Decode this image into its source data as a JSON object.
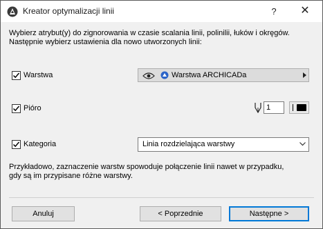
{
  "window": {
    "title": "Kreator optymalizacji linii",
    "help_label": "?",
    "close_label": "✕"
  },
  "intro": {
    "line1": "Wybierz atrybut(y) do zignorowania w czasie scalania linii, polinilii, łuków i okręgów.",
    "line2": "Następnie wybierz ustawienia dla nowo utworzonych linii:"
  },
  "options": {
    "layer": {
      "label": "Warstwa",
      "checked": true,
      "value": "Warstwa ARCHICADa"
    },
    "pen": {
      "label": "Pióro",
      "checked": true,
      "value": "1"
    },
    "category": {
      "label": "Kategoria",
      "checked": true,
      "value": "Linia rozdzielająca warstwy"
    }
  },
  "note": {
    "line1": "Przykładowo, zaznaczenie warstw spowoduje połączenie linii nawet w przypadku,",
    "line2": "gdy są im przypisane różne warstwy."
  },
  "buttons": {
    "cancel": "Anuluj",
    "previous": "< Poprzednie",
    "next": "Następne >"
  },
  "colors": {
    "accent": "#0078d7",
    "client_bg": "#f0f0f0"
  }
}
